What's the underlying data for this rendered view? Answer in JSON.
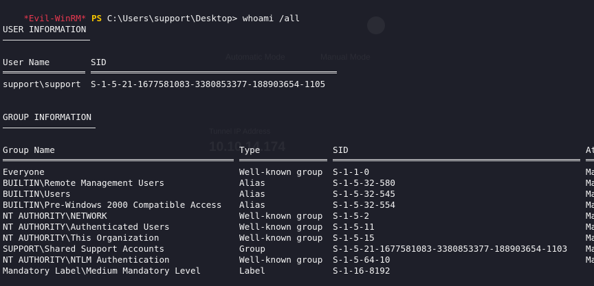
{
  "prompt": {
    "shell": "*Evil-WinRM*",
    "ps": "PS",
    "path": "C:\\Users\\support\\Desktop>",
    "command": "whoami /all"
  },
  "user_info": {
    "heading": "USER INFORMATION",
    "columns": {
      "user_name": "User Name",
      "sid": "SID"
    },
    "row": {
      "user_name": "support\\support",
      "sid": "S-1-5-21-1677581083-3380853377-188903654-1105"
    }
  },
  "group_info": {
    "heading": "GROUP INFORMATION",
    "columns": {
      "group_name": "Group Name",
      "type": "Type",
      "sid": "SID",
      "attributes": "At"
    },
    "rows": [
      {
        "name": "Everyone",
        "type": "Well-known group",
        "sid": "S-1-1-0",
        "attr": "Ma"
      },
      {
        "name": "BUILTIN\\Remote Management Users",
        "type": "Alias",
        "sid": "S-1-5-32-580",
        "attr": "Ma"
      },
      {
        "name": "BUILTIN\\Users",
        "type": "Alias",
        "sid": "S-1-5-32-545",
        "attr": "Ma"
      },
      {
        "name": "BUILTIN\\Pre-Windows 2000 Compatible Access",
        "type": "Alias",
        "sid": "S-1-5-32-554",
        "attr": "Ma"
      },
      {
        "name": "NT AUTHORITY\\NETWORK",
        "type": "Well-known group",
        "sid": "S-1-5-2",
        "attr": "Ma"
      },
      {
        "name": "NT AUTHORITY\\Authenticated Users",
        "type": "Well-known group",
        "sid": "S-1-5-11",
        "attr": "Ma"
      },
      {
        "name": "NT AUTHORITY\\This Organization",
        "type": "Well-known group",
        "sid": "S-1-5-15",
        "attr": "Ma"
      },
      {
        "name": "SUPPORT\\Shared Support Accounts",
        "type": "Group",
        "sid": "S-1-5-21-1677581083-3380853377-188903654-1103",
        "attr": "Ma"
      },
      {
        "name": "NT AUTHORITY\\NTLM Authentication",
        "type": "Well-known group",
        "sid": "S-1-5-64-10",
        "attr": "Ma"
      },
      {
        "name": "Mandatory Label\\Medium Mandatory Level",
        "type": "Label",
        "sid": "S-1-16-8192",
        "attr": ""
      }
    ]
  },
  "background_overlay": {
    "mode_a": "Automatic Mode",
    "mode_b": "Manual Mode",
    "ip_label": "Tunnel IP Address",
    "ip_value": "10.10.14.174"
  }
}
